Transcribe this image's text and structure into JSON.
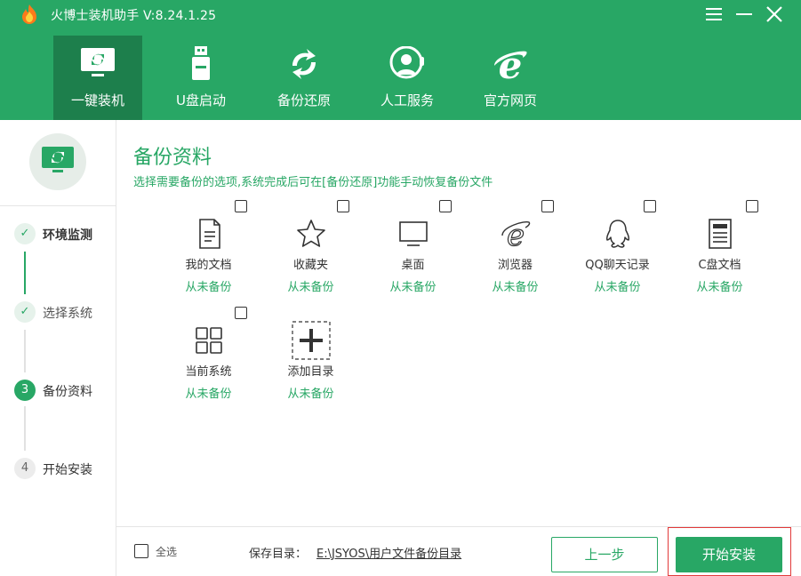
{
  "app": {
    "title": "火博士装机助手 V:8.24.1.25"
  },
  "window_controls": {
    "menu_icon": "menu-icon",
    "minimize_icon": "minimize-icon",
    "close_icon": "close-icon"
  },
  "nav": {
    "tabs": [
      {
        "label": "一键装机",
        "icon": "monitor-refresh-icon",
        "active": true
      },
      {
        "label": "U盘启动",
        "icon": "usb-drive-icon",
        "active": false
      },
      {
        "label": "备份还原",
        "icon": "sync-arrows-icon",
        "active": false
      },
      {
        "label": "人工服务",
        "icon": "customer-service-icon",
        "active": false
      },
      {
        "label": "官方网页",
        "icon": "browser-e-icon",
        "active": false
      }
    ]
  },
  "sidebar": {
    "hero_icon": "monitor-refresh-icon",
    "steps": [
      {
        "marker": "✓",
        "label": "环境监测",
        "state": "done"
      },
      {
        "marker": "✓",
        "label": "选择系统",
        "state": "done"
      },
      {
        "marker": "3",
        "label": "备份资料",
        "state": "active"
      },
      {
        "marker": "4",
        "label": "开始安装",
        "state": "pending"
      }
    ]
  },
  "main": {
    "title": "备份资料",
    "description": "选择需要备份的选项,系统完成后可在[备份还原]功能手动恢复备份文件",
    "items": [
      {
        "name": "我的文档",
        "status": "从未备份",
        "icon": "document-icon",
        "checked": false
      },
      {
        "name": "收藏夹",
        "status": "从未备份",
        "icon": "star-icon",
        "checked": false
      },
      {
        "name": "桌面",
        "status": "从未备份",
        "icon": "desktop-monitor-icon",
        "checked": false
      },
      {
        "name": "浏览器",
        "status": "从未备份",
        "icon": "ie-browser-icon",
        "checked": false
      },
      {
        "name": "QQ聊天记录",
        "status": "从未备份",
        "icon": "qq-penguin-icon",
        "checked": false
      },
      {
        "name": "C盘文档",
        "status": "从未备份",
        "icon": "c-drive-document-icon",
        "checked": false
      },
      {
        "name": "当前系统",
        "status": "从未备份",
        "icon": "system-grid-icon",
        "checked": false
      },
      {
        "name": "添加目录",
        "status": "从未备份",
        "icon": "add-directory-icon",
        "checked": null
      }
    ]
  },
  "footer": {
    "select_all_label": "全选",
    "save_dir_label": "保存目录：",
    "save_dir_path": "E:\\JSYOS\\用户文件备份目录",
    "prev_button": "上一步",
    "start_button": "开始安装"
  },
  "colors": {
    "brand_green": "#28a765",
    "active_tab": "#1d7f4c",
    "highlight_red": "#e23a3a"
  }
}
